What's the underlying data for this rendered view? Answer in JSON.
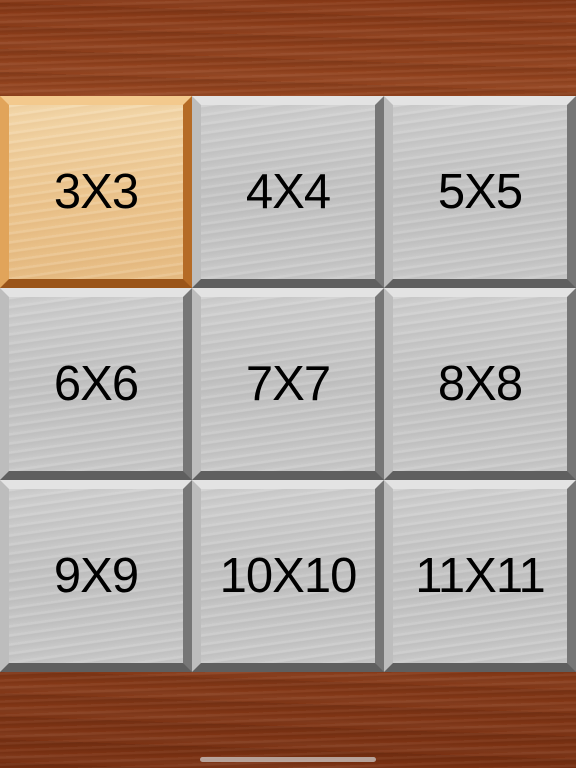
{
  "board_sizes": [
    {
      "label": "3X3",
      "selected": true
    },
    {
      "label": "4X4",
      "selected": false
    },
    {
      "label": "5X5",
      "selected": false
    },
    {
      "label": "6X6",
      "selected": false
    },
    {
      "label": "7X7",
      "selected": false
    },
    {
      "label": "8X8",
      "selected": false
    },
    {
      "label": "9X9",
      "selected": false
    },
    {
      "label": "10X10",
      "selected": false
    },
    {
      "label": "11X11",
      "selected": false
    }
  ],
  "colors": {
    "selected_tile": "#ecc58e",
    "tile": "#c9c9c9",
    "background_wood": "#8a3a17"
  }
}
